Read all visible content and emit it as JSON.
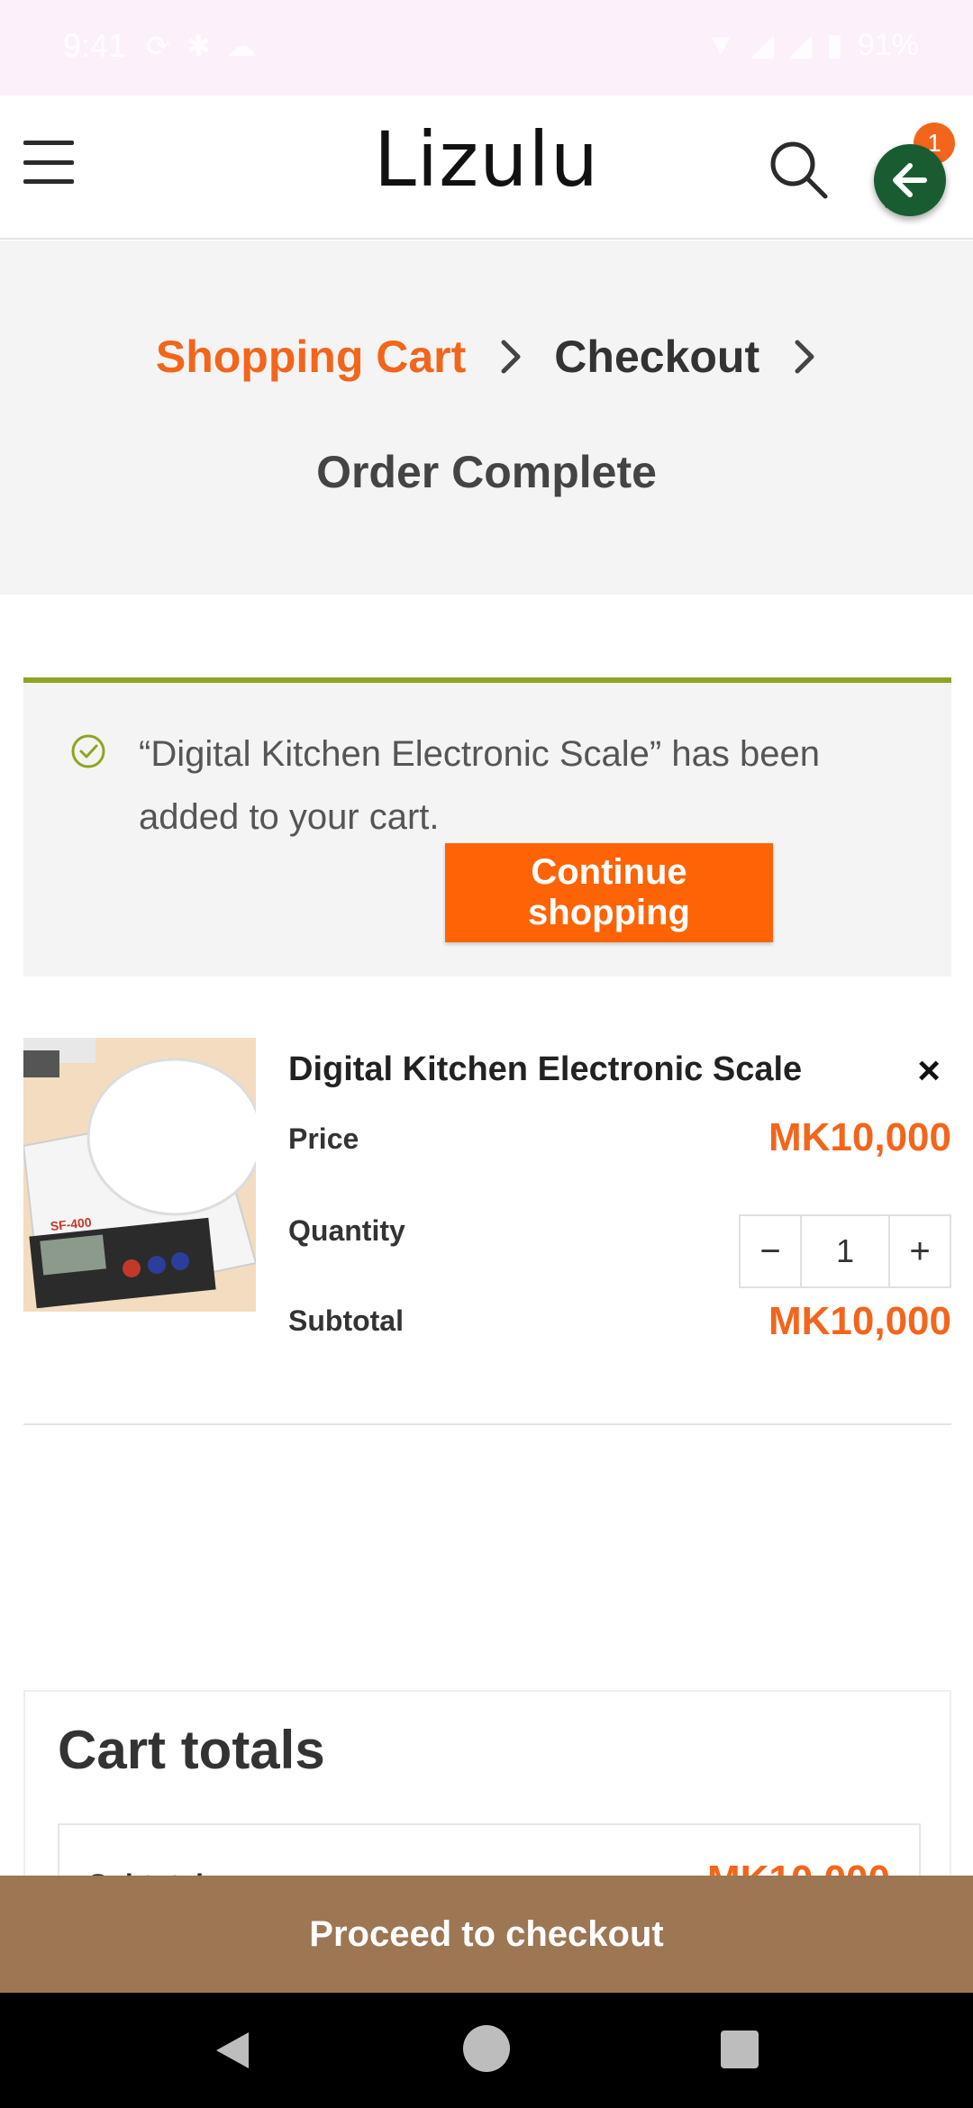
{
  "status_bar": {
    "time": "9:41",
    "battery": "91%",
    "left_icons": [
      "sync-icon",
      "bug-icon",
      "cloud-icon"
    ],
    "right_icons": [
      "wifi-icon",
      "signal-icon",
      "signal-icon",
      "battery-icon"
    ]
  },
  "header": {
    "logo": "Lizulu",
    "cart_count": "1",
    "icons": [
      "menu-icon",
      "search-icon",
      "cart-icon",
      "back-arrow-icon"
    ]
  },
  "breadcrumb": {
    "steps": [
      "Shopping Cart",
      "Checkout",
      "Order Complete"
    ],
    "active_index": 0
  },
  "notice": {
    "message": "“Digital Kitchen Electronic Scale” has been added to your cart.",
    "button_label": "Continue shopping"
  },
  "cart_item": {
    "name": "Digital Kitchen Electronic Scale",
    "remove_label": "×",
    "price_label": "Price",
    "price": "MK10,000",
    "quantity_label": "Quantity",
    "quantity": "1",
    "decrement": "−",
    "increment": "+",
    "subtotal_label": "Subtotal",
    "subtotal": "MK10,000",
    "thumb_model": "SF-400"
  },
  "totals": {
    "title": "Cart totals",
    "subtotal_label": "Subtotal",
    "subtotal": "MK10,000"
  },
  "checkout": {
    "label": "Proceed to checkout"
  },
  "colors": {
    "accent": "#f2661c",
    "button": "#fe6405",
    "notice_border": "#8ea521",
    "proceed": "#9d7653",
    "fab": "#1a5c32"
  }
}
